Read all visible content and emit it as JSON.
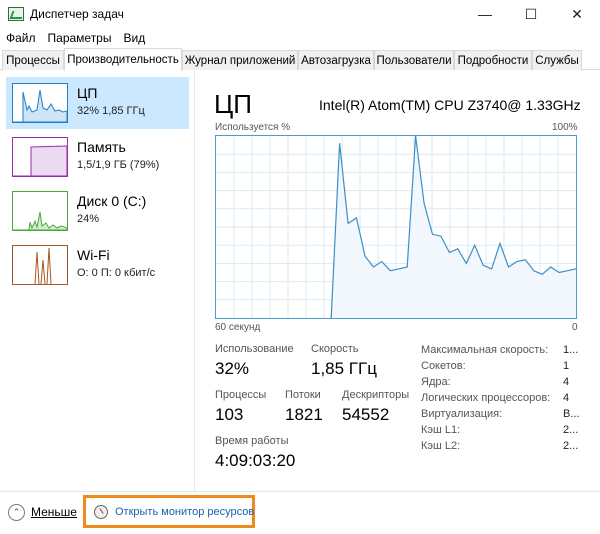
{
  "window": {
    "title": "Диспетчер задач",
    "minimize_glyph": "—",
    "maximize_glyph": "☐",
    "close_glyph": "✕"
  },
  "menu": {
    "items": [
      "Файл",
      "Параметры",
      "Вид"
    ]
  },
  "tabs": [
    "Процессы",
    "Производительность",
    "Журнал приложений",
    "Автозагрузка",
    "Пользователи",
    "Подробности",
    "Службы"
  ],
  "active_tab": "Производительность",
  "sidebar": {
    "items": [
      {
        "name": "ЦП",
        "sub": "32% 1,85 ГГц",
        "color": "#1e81c8"
      },
      {
        "name": "Память",
        "sub": "1,5/1,9 ГБ (79%)",
        "color": "#9b2bb0"
      },
      {
        "name": "Диск 0 (C:)",
        "sub": "24%",
        "color": "#4aa83c"
      },
      {
        "name": "Wi-Fi",
        "sub": "О: 0 П: 0 кбит/с",
        "color": "#a8561d"
      }
    ]
  },
  "main": {
    "title": "ЦП",
    "cpu_name": "Intel(R) Atom(TM) CPU Z3740@ 1.33GHz",
    "graph_label": "Используется %",
    "graph_max": "100%",
    "graph_time": "60 секунд",
    "graph_zero": "0",
    "stats": {
      "usage_label": "Использование",
      "usage_value": "32%",
      "speed_label": "Скорость",
      "speed_value": "1,85 ГГц",
      "processes_label": "Процессы",
      "processes_value": "103",
      "threads_label": "Потоки",
      "threads_value": "1821",
      "handles_label": "Дескрипторы",
      "handles_value": "54552",
      "uptime_label": "Время работы",
      "uptime_value": "4:09:03:20"
    },
    "specs": [
      {
        "label": "Максимальная скорость:",
        "value": "1..."
      },
      {
        "label": "Сокетов:",
        "value": "1"
      },
      {
        "label": "Ядра:",
        "value": "4"
      },
      {
        "label": "Логических процессоров:",
        "value": "4"
      },
      {
        "label": "Виртуализация:",
        "value": "В..."
      },
      {
        "label": "Кэш L1:",
        "value": "2..."
      },
      {
        "label": "Кэш L2:",
        "value": "2..."
      }
    ]
  },
  "cpu_usage_history_percent": [
    0,
    96,
    52,
    55,
    34,
    28,
    31,
    26,
    27,
    28,
    100,
    63,
    46,
    45,
    36,
    38,
    30,
    40,
    29,
    27,
    41,
    28,
    31,
    32,
    26,
    24,
    28,
    25,
    26,
    27
  ],
  "footer": {
    "less_label": "Меньше",
    "less_glyph": "⌃",
    "resmon_label": "Открыть монитор ресурсов",
    "highlight_color": "#f08a1c"
  }
}
